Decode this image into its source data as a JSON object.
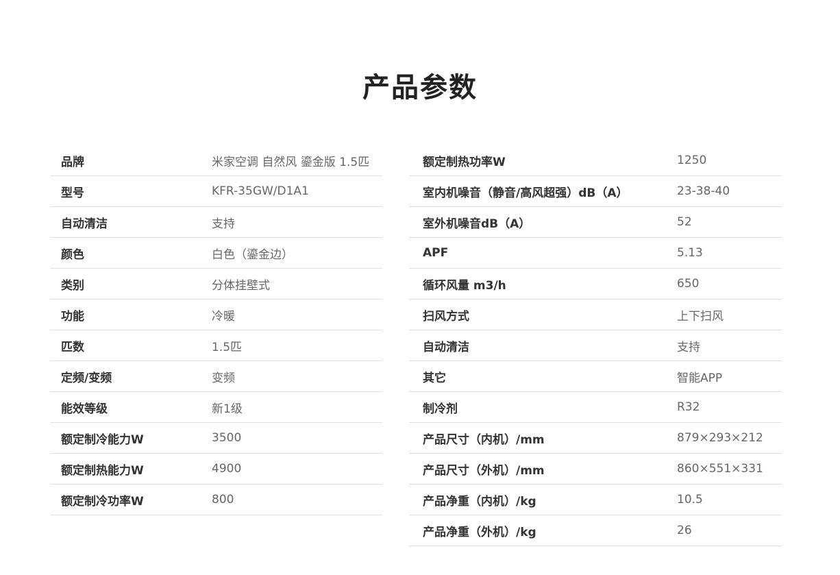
{
  "title": "产品参数",
  "left_specs": [
    {
      "label": "品牌",
      "value": "米家空调 自然风 鎏金版 1.5匹"
    },
    {
      "label": "型号",
      "value": "KFR-35GW/D1A1"
    },
    {
      "label": "自动清洁",
      "value": "支持"
    },
    {
      "label": "颜色",
      "value": "白色（鎏金边）"
    },
    {
      "label": "类别",
      "value": "分体挂壁式"
    },
    {
      "label": "功能",
      "value": "冷暖"
    },
    {
      "label": "匹数",
      "value": "1.5匹"
    },
    {
      "label": "定频/变频",
      "value": "变频"
    },
    {
      "label": "能效等级",
      "value": "新1级"
    },
    {
      "label": "额定制冷能力W",
      "value": "3500"
    },
    {
      "label": "额定制热能力W",
      "value": "4900"
    },
    {
      "label": "额定制冷功率W",
      "value": "800"
    }
  ],
  "right_specs": [
    {
      "label": "额定制热功率W",
      "value": "1250"
    },
    {
      "label": "室内机噪音（静音/高风超强）dB（A）",
      "value": "23-38-40"
    },
    {
      "label": "室外机噪音dB（A）",
      "value": "52"
    },
    {
      "label": "APF",
      "value": "5.13"
    },
    {
      "label": "循环风量 m3/h",
      "value": "650"
    },
    {
      "label": "扫风方式",
      "value": "上下扫风"
    },
    {
      "label": "自动清洁",
      "value": "支持"
    },
    {
      "label": "其它",
      "value": "智能APP"
    },
    {
      "label": "制冷剂",
      "value": "R32"
    },
    {
      "label": "产品尺寸（内机）/mm",
      "value": "879×293×212"
    },
    {
      "label": "产品尺寸（外机）/mm",
      "value": "860×551×331"
    },
    {
      "label": "产品净重（内机）/kg",
      "value": "10.5"
    },
    {
      "label": "产品净重（外机）/kg",
      "value": "26"
    }
  ]
}
